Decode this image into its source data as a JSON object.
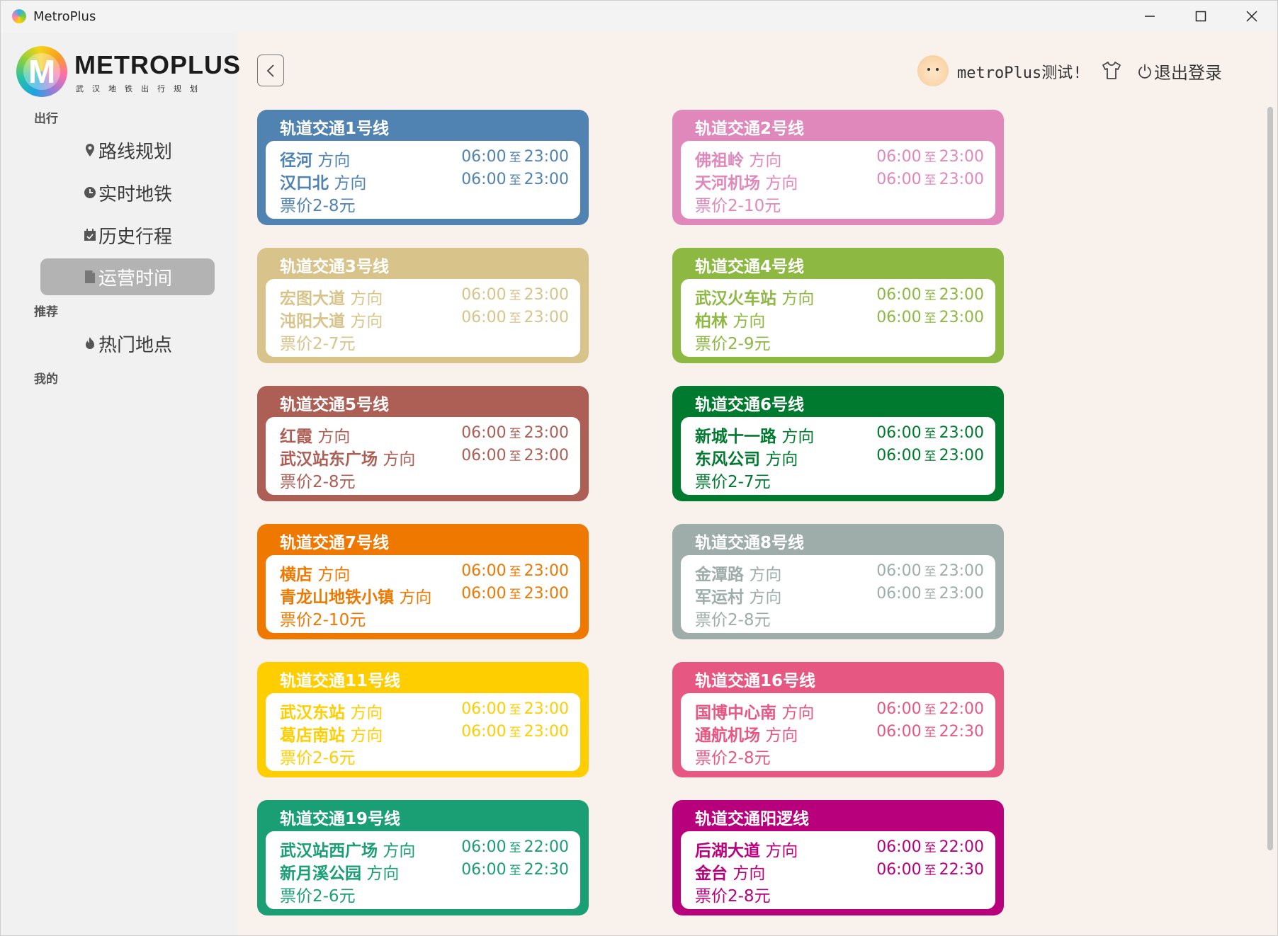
{
  "window": {
    "title": "MetroPlus",
    "controls": [
      "minimize-icon",
      "maximize-icon",
      "close-icon"
    ]
  },
  "logo": {
    "text": "METROPLUS",
    "subtitle": "武汉地铁出行规划"
  },
  "sidebar": {
    "sections": [
      {
        "label": "出行",
        "items": [
          {
            "label": "路线规划",
            "icon": "location-pin-icon"
          },
          {
            "label": "实时地铁",
            "icon": "clock-icon"
          },
          {
            "label": "历史行程",
            "icon": "calendar-icon"
          },
          {
            "label": "运营时间",
            "icon": "document-icon",
            "active": true
          }
        ]
      },
      {
        "label": "推荐",
        "items": [
          {
            "label": "热门地点",
            "icon": "fire-icon"
          }
        ]
      },
      {
        "label": "我的",
        "items": []
      }
    ]
  },
  "header": {
    "username": "metroPlus测试!",
    "logout_label": "退出登录"
  },
  "common": {
    "direction_word": "方向",
    "to_word": "至"
  },
  "lines": [
    {
      "title": "轨道交通1号线",
      "color": "#5183b2",
      "d1": "径河",
      "d2": "汉口北",
      "t1s": "06:00",
      "t1e": "23:00",
      "t2s": "06:00",
      "t2e": "23:00",
      "price": "票价2-8元"
    },
    {
      "title": "轨道交通2号线",
      "color": "#e087bb",
      "d1": "佛祖岭",
      "d2": "天河机场",
      "t1s": "06:00",
      "t1e": "23:00",
      "t2s": "06:00",
      "t2e": "23:00",
      "price": "票价2-10元"
    },
    {
      "title": "轨道交通3号线",
      "color": "#d8c48a",
      "d1": "宏图大道",
      "d2": "沌阳大道",
      "t1s": "06:00",
      "t1e": "23:00",
      "t2s": "06:00",
      "t2e": "23:00",
      "price": "票价2-7元"
    },
    {
      "title": "轨道交通4号线",
      "color": "#8db841",
      "d1": "武汉火车站",
      "d2": "柏林",
      "t1s": "06:00",
      "t1e": "23:00",
      "t2s": "06:00",
      "t2e": "23:00",
      "price": "票价2-9元"
    },
    {
      "title": "轨道交通5号线",
      "color": "#ad5e55",
      "d1": "红霞",
      "d2": "武汉站东广场",
      "t1s": "06:00",
      "t1e": "23:00",
      "t2s": "06:00",
      "t2e": "23:00",
      "price": "票价2-8元"
    },
    {
      "title": "轨道交通6号线",
      "color": "#007a2e",
      "d1": "新城十一路",
      "d2": "东风公司",
      "t1s": "06:00",
      "t1e": "23:00",
      "t2s": "06:00",
      "t2e": "23:00",
      "price": "票价2-7元"
    },
    {
      "title": "轨道交通7号线",
      "color": "#ef7800",
      "d1": "横店",
      "d2": "青龙山地铁小镇",
      "t1s": "06:00",
      "t1e": "23:00",
      "t2s": "06:00",
      "t2e": "23:00",
      "price": "票价2-10元"
    },
    {
      "title": "轨道交通8号线",
      "color": "#9fadaa",
      "d1": "金潭路",
      "d2": "军运村",
      "t1s": "06:00",
      "t1e": "23:00",
      "t2s": "06:00",
      "t2e": "23:00",
      "price": "票价2-8元"
    },
    {
      "title": "轨道交通11号线",
      "color": "#ffce00",
      "d1": "武汉东站",
      "d2": "葛店南站",
      "t1s": "06:00",
      "t1e": "23:00",
      "t2s": "06:00",
      "t2e": "23:00",
      "price": "票价2-6元"
    },
    {
      "title": "轨道交通16号线",
      "color": "#e65882",
      "d1": "国博中心南",
      "d2": "通航机场",
      "t1s": "06:00",
      "t1e": "22:00",
      "t2s": "06:00",
      "t2e": "22:30",
      "price": "票价2-8元"
    },
    {
      "title": "轨道交通19号线",
      "color": "#1a9f75",
      "d1": "武汉站西广场",
      "d2": "新月溪公园",
      "t1s": "06:00",
      "t1e": "22:00",
      "t2s": "06:00",
      "t2e": "22:30",
      "price": "票价2-6元"
    },
    {
      "title": "轨道交通阳逻线",
      "color": "#b8007d",
      "d1": "后湖大道",
      "d2": "金台",
      "t1s": "06:00",
      "t1e": "22:00",
      "t2s": "06:00",
      "t2e": "22:30",
      "price": "票价2-8元"
    }
  ]
}
